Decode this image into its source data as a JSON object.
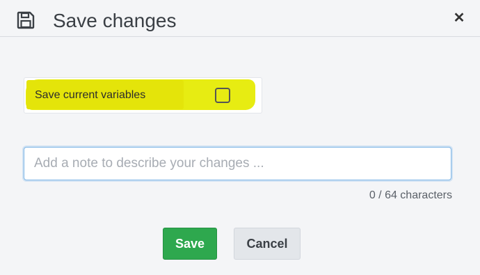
{
  "dialog": {
    "title": "Save changes",
    "header_icon": "floppy-disk-icon",
    "close_label": "✕"
  },
  "checkbox": {
    "label": "Save current variables",
    "checked": false,
    "highlight_color": "#e7ec12"
  },
  "note": {
    "value": "",
    "placeholder": "Add a note to describe your changes ...",
    "char_count": "0 / 64 characters"
  },
  "buttons": {
    "save_label": "Save",
    "cancel_label": "Cancel",
    "save_color": "#2ea84e",
    "cancel_color": "#e3e6ea"
  }
}
